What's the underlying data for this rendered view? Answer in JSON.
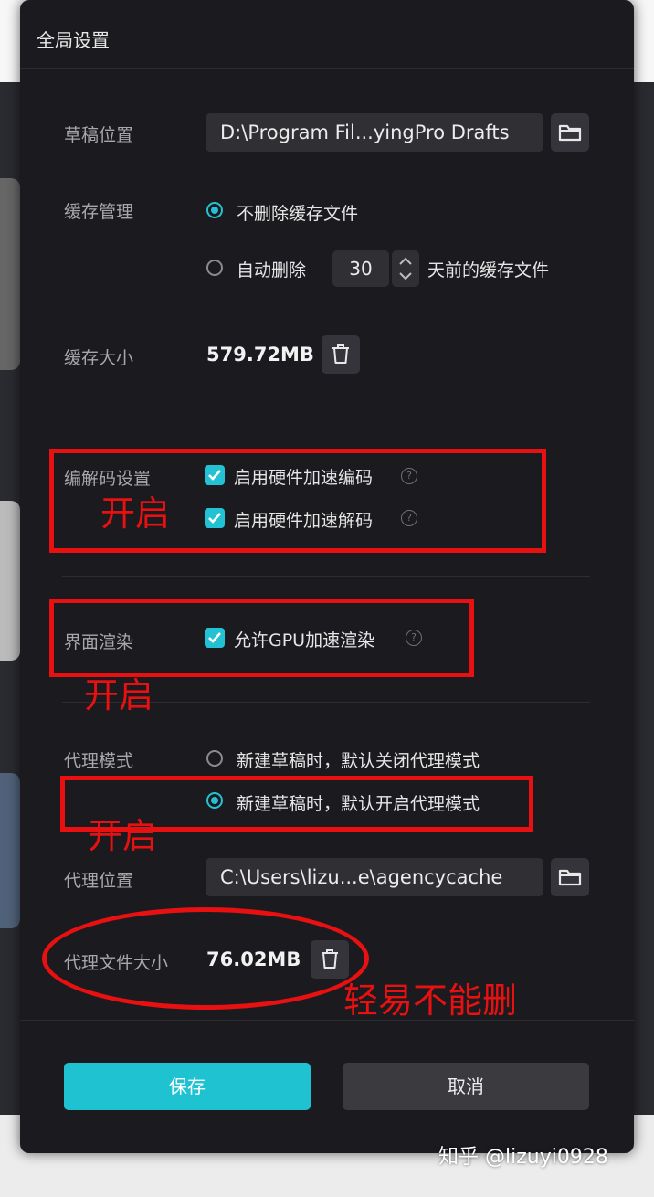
{
  "dialog": {
    "title": "全局设置"
  },
  "draft": {
    "label": "草稿位置",
    "path": "D:\\Program Fil...yingPro Drafts"
  },
  "cache": {
    "label": "缓存管理",
    "option_keep": "不删除缓存文件",
    "option_auto": "自动删除",
    "days": "30",
    "days_suffix": "天前的缓存文件"
  },
  "cache_size": {
    "label": "缓存大小",
    "value": "579.72MB"
  },
  "codec": {
    "label": "编解码设置",
    "encode": "启用硬件加速编码",
    "decode": "启用硬件加速解码"
  },
  "render": {
    "label": "界面渲染",
    "gpu": "允许GPU加速渲染"
  },
  "proxy": {
    "label": "代理模式",
    "option_off": "新建草稿时，默认关闭代理模式",
    "option_on": "新建草稿时，默认开启代理模式"
  },
  "proxy_location": {
    "label": "代理位置",
    "path": "C:\\Users\\lizu...e\\agencycache"
  },
  "proxy_size": {
    "label": "代理文件大小",
    "value": "76.02MB"
  },
  "buttons": {
    "save": "保存",
    "cancel": "取消"
  },
  "annotations": {
    "codec_note": "开启",
    "render_note": "开启",
    "proxy_note": "开启",
    "proxy_size_note": "轻易不能删",
    "color": "#e81010"
  },
  "watermark": "知乎 @lizuyi0928",
  "colors": {
    "accent": "#22c1d3",
    "dialog_bg": "#1b1b1f"
  }
}
